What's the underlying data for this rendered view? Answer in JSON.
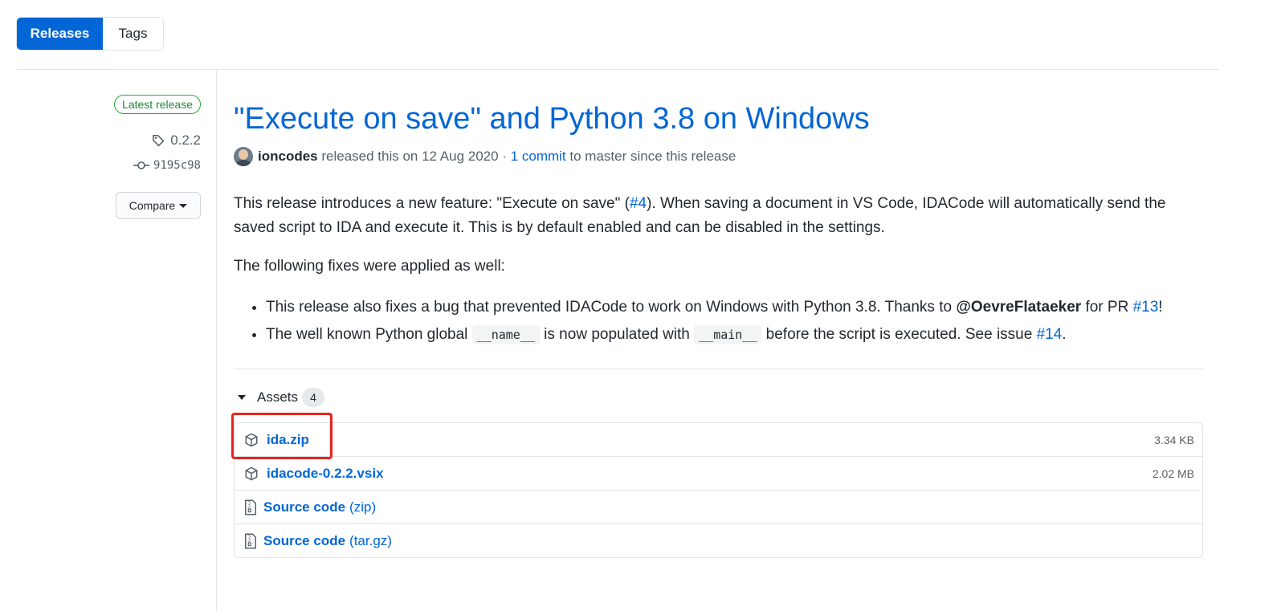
{
  "tabs": {
    "releases": "Releases",
    "tags": "Tags"
  },
  "sidebar": {
    "latest_badge": "Latest release",
    "tag": "0.2.2",
    "commit": "9195c98",
    "compare": "Compare"
  },
  "release": {
    "title": "\"Execute on save\" and Python 3.8 on Windows",
    "author": "ioncodes",
    "released_text": " released this on 12 Aug 2020 · ",
    "commit_link": "1 commit",
    "since_text": " to master since this release",
    "p1_a": "This release introduces a new feature: \"Execute on save\" (",
    "p1_link": "#4",
    "p1_b": "). When saving a document in VS Code, IDACode will automatically send the saved script to IDA and execute it. This is by default enabled and can be disabled in the settings.",
    "p2": "The following fixes were applied as well:",
    "fix1_a": "This release also fixes a bug that prevented IDACode to work on Windows with Python 3.8. Thanks to ",
    "fix1_user": "@OevreFlataeker",
    "fix1_b": " for PR ",
    "fix1_link": "#13",
    "fix1_c": "!",
    "fix2_a": "The well known Python global ",
    "fix2_code1": "__name__",
    "fix2_b": " is now populated with ",
    "fix2_code2": "__main__",
    "fix2_c": " before the script is executed. See issue ",
    "fix2_link": "#14",
    "fix2_d": "."
  },
  "assets": {
    "label": "Assets",
    "count": "4",
    "items": [
      {
        "name": "ida.zip",
        "size": "3.34 KB"
      },
      {
        "name": "idacode-0.2.2.vsix",
        "size": "2.02 MB"
      },
      {
        "name": "Source code",
        "sub": "(zip)"
      },
      {
        "name": "Source code",
        "sub": "(tar.gz)"
      }
    ]
  },
  "colors": {
    "accent": "#0366d6",
    "badge_green": "#28a745",
    "highlight": "#e8221b"
  }
}
